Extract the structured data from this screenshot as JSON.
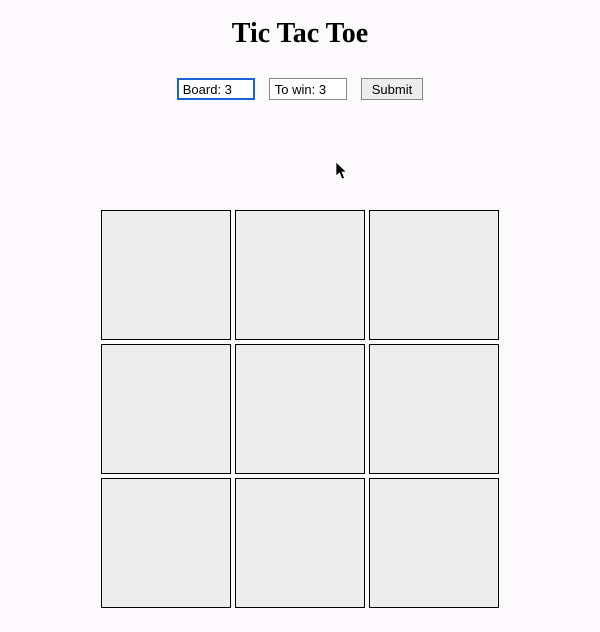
{
  "title": "Tic Tac Toe",
  "controls": {
    "board_value": "Board: 3",
    "towin_value": "To win: 3",
    "submit_label": "Submit"
  },
  "grid": {
    "size": 3,
    "cells": [
      "",
      "",
      "",
      "",
      "",
      "",
      "",
      "",
      ""
    ]
  }
}
